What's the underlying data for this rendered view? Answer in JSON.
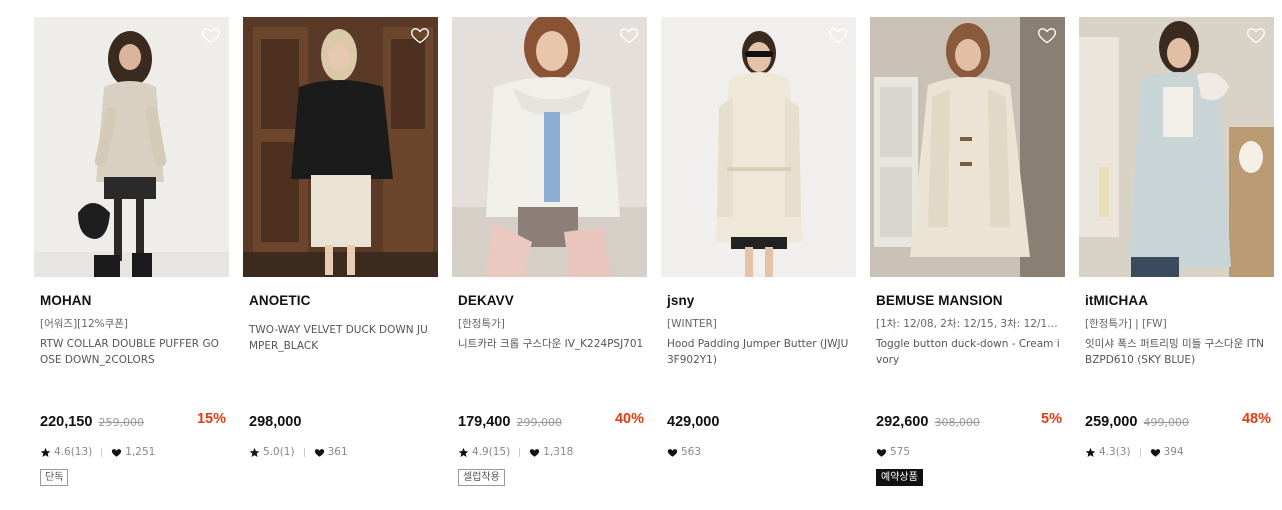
{
  "products": [
    {
      "brand": "MOHAN",
      "tag": "[어워즈][12%쿠폰]",
      "name": "RTW COLLAR DOUBLE PUFFER GOOSE DOWN_2COLORS",
      "price": "220,150",
      "original_price": "259,000",
      "discount": "15%",
      "rating": "4.6(13)",
      "likes": "1,251",
      "badge": "단독",
      "badge_style": "outline",
      "wishlisted": false
    },
    {
      "brand": "ANOETIC",
      "tag": "",
      "name": "TWO-WAY VELVET DUCK DOWN JUMPER_BLACK",
      "price": "298,000",
      "original_price": "",
      "discount": "",
      "rating": "5.0(1)",
      "likes": "361",
      "badge": "",
      "wishlisted": false
    },
    {
      "brand": "DEKAVV",
      "tag": "[한정특가]",
      "name": "니트카라 크롭 구스다운 IV_K224PSJ701",
      "price": "179,400",
      "original_price": "299,000",
      "discount": "40%",
      "rating": "4.9(15)",
      "likes": "1,318",
      "badge": "셀럽착용",
      "badge_style": "outline",
      "wishlisted": false
    },
    {
      "brand": "jsny",
      "tag": "[WINTER]",
      "name": "Hood Padding Jumper Butter (JWJU3F902Y1)",
      "price": "429,000",
      "original_price": "",
      "discount": "",
      "rating": "",
      "likes": "563",
      "badge": "",
      "wishlisted": false
    },
    {
      "brand": "BEMUSE MANSION",
      "tag": "[1차: 12/08, 2차: 12/15, 3차: 12/19 ...",
      "name": "Toggle button duck-down - Cream ivory",
      "price": "292,600",
      "original_price": "308,000",
      "discount": "5%",
      "rating": "",
      "likes": "575",
      "badge": "예약상품",
      "badge_style": "filled",
      "wishlisted": false
    },
    {
      "brand": "itMICHAA",
      "tag": "[한정특가] | [FW]",
      "name": "잇미샤 폭스 퍼트리밍 미들 구스다운 ITNBZPD610 (SKY BLUE)",
      "price": "259,000",
      "original_price": "499,000",
      "discount": "48%",
      "rating": "4.3(3)",
      "likes": "394",
      "badge": "",
      "wishlisted": false
    }
  ],
  "icons": {
    "wishlist": "heart-outline-icon",
    "rating": "star-icon",
    "likes": "heart-icon"
  },
  "colors": {
    "discount": "#e63b12",
    "brand_text": "#111111",
    "meta_text": "#888888"
  }
}
